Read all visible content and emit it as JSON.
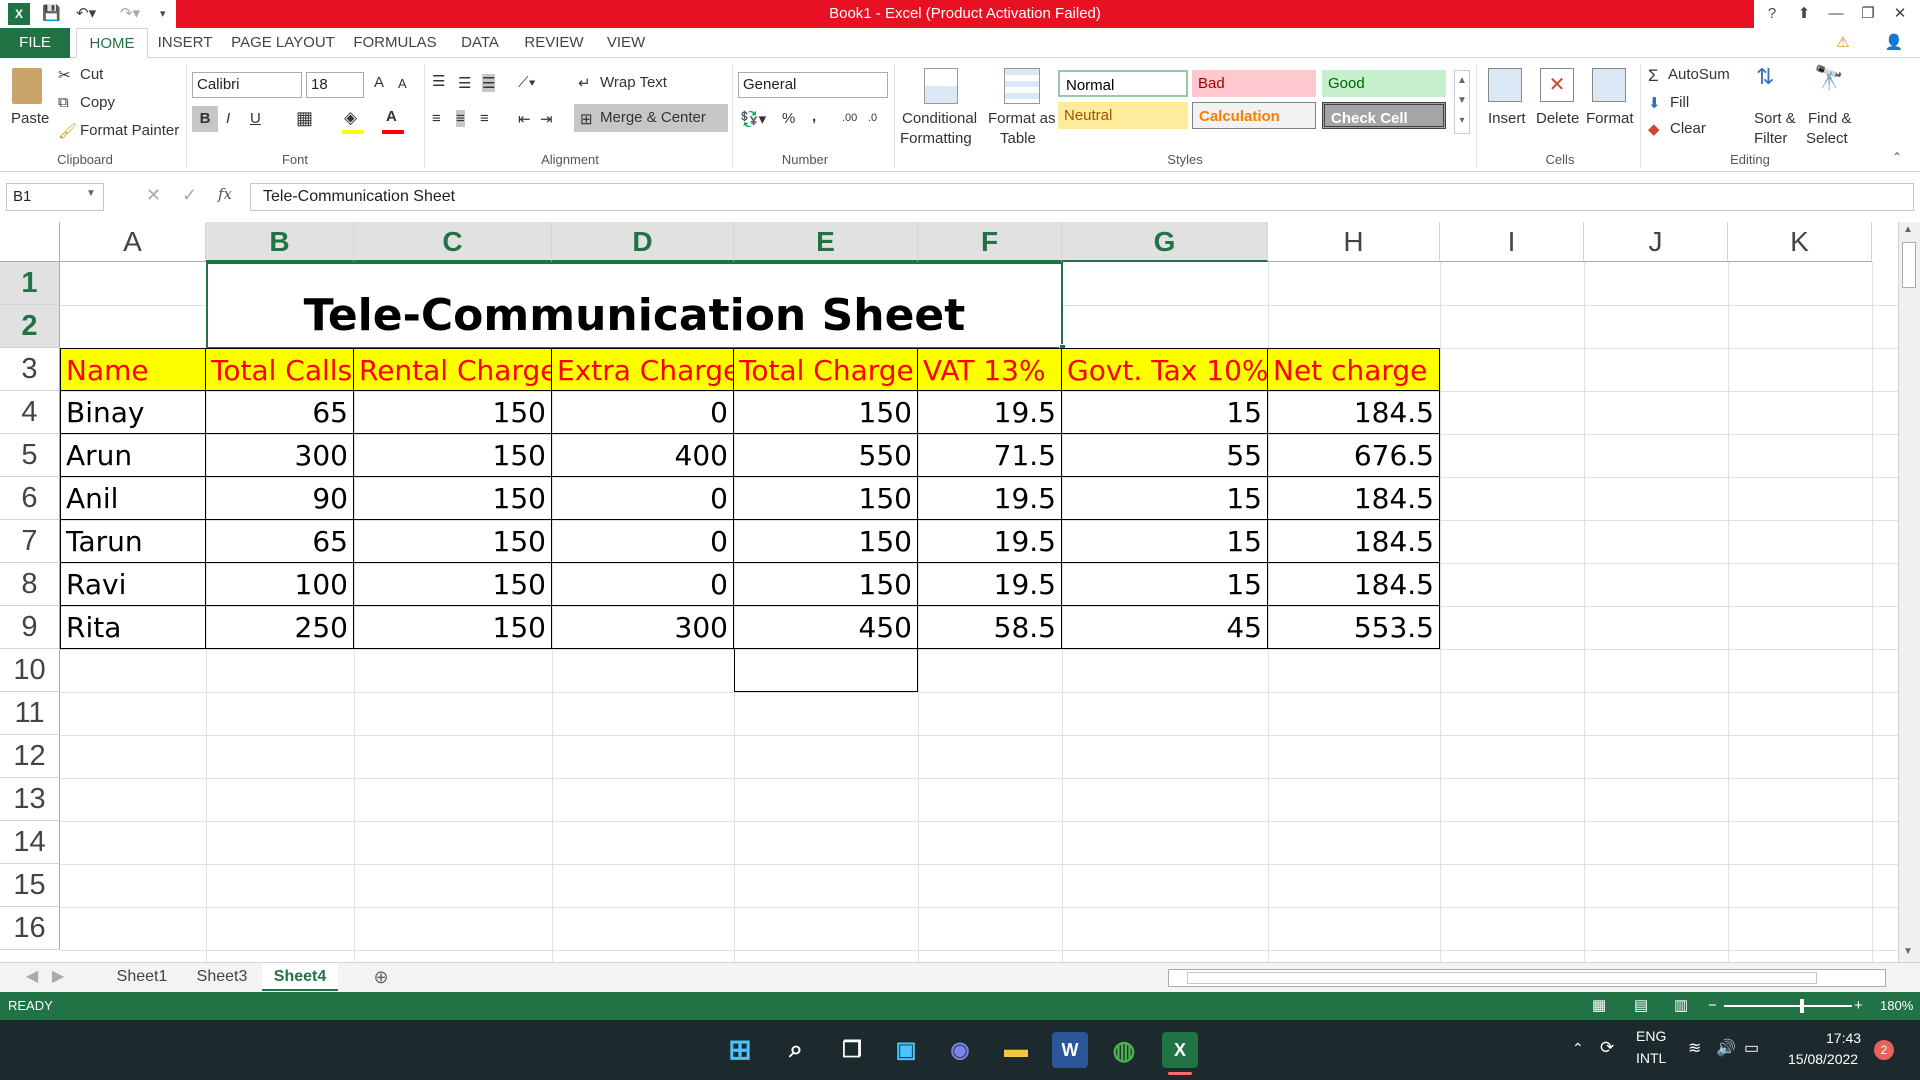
{
  "titlebar": {
    "title": "Book1  -  Excel (Product Activation Failed)",
    "help": "?",
    "minimize": "—",
    "restore": "❐",
    "close": "✕"
  },
  "tabs": [
    "FILE",
    "HOME",
    "INSERT",
    "PAGE LAYOUT",
    "FORMULAS",
    "DATA",
    "REVIEW",
    "VIEW"
  ],
  "ribbon": {
    "clipboard": {
      "paste": "Paste",
      "cut": "Cut",
      "copy": "Copy",
      "format_painter": "Format Painter",
      "label": "Clipboard"
    },
    "font": {
      "family": "Calibri",
      "size": "18",
      "bold": "B",
      "italic": "I",
      "underline": "U",
      "label": "Font"
    },
    "alignment": {
      "wrap_text": "Wrap Text",
      "merge_center": "Merge & Center",
      "label": "Alignment"
    },
    "number": {
      "format": "General",
      "percent": "%",
      "comma": ",",
      "label": "Number"
    },
    "styles": {
      "conditional_1": "Conditional",
      "conditional_2": "Formatting",
      "format_table_1": "Format as",
      "format_table_2": "Table",
      "normal": "Normal",
      "bad": "Bad",
      "good": "Good",
      "neutral": "Neutral",
      "calculation": "Calculation",
      "check_cell": "Check Cell",
      "label": "Styles"
    },
    "cells": {
      "insert": "Insert",
      "delete": "Delete",
      "format": "Format",
      "label": "Cells"
    },
    "editing": {
      "autosum": "AutoSum",
      "fill": "Fill",
      "clear": "Clear",
      "sort_1": "Sort &",
      "sort_2": "Filter",
      "find_1": "Find &",
      "find_2": "Select",
      "label": "Editing"
    }
  },
  "formula_bar": {
    "name_box": "B1",
    "fx": "fx",
    "content": "Tele-Communication Sheet"
  },
  "columns": [
    "A",
    "B",
    "C",
    "D",
    "E",
    "F",
    "G",
    "H",
    "I",
    "J",
    "K"
  ],
  "rows": [
    "1",
    "2",
    "3",
    "4",
    "5",
    "6",
    "7",
    "8",
    "9",
    "10",
    "11",
    "12",
    "13",
    "14",
    "15",
    "16"
  ],
  "sheet": {
    "title": "Tele-Communication Sheet",
    "headers": [
      "Name",
      "Total Calls",
      "Rental Charge",
      "Extra Charge",
      "Total Charge",
      "VAT 13%",
      "Govt. Tax 10%",
      "Net charge"
    ],
    "data": [
      [
        "Binay",
        "65",
        "150",
        "0",
        "150",
        "19.5",
        "15",
        "184.5"
      ],
      [
        "Arun",
        "300",
        "150",
        "400",
        "550",
        "71.5",
        "55",
        "676.5"
      ],
      [
        "Anil",
        "90",
        "150",
        "0",
        "150",
        "19.5",
        "15",
        "184.5"
      ],
      [
        "Tarun",
        "65",
        "150",
        "0",
        "150",
        "19.5",
        "15",
        "184.5"
      ],
      [
        "Ravi",
        "100",
        "150",
        "0",
        "150",
        "19.5",
        "15",
        "184.5"
      ],
      [
        "Rita",
        "250",
        "150",
        "300",
        "450",
        "58.5",
        "45",
        "553.5"
      ]
    ]
  },
  "sheet_tabs": [
    "Sheet1",
    "Sheet3",
    "Sheet4"
  ],
  "status": {
    "ready": "READY",
    "zoom": "180%"
  },
  "taskbar": {
    "lang_1": "ENG",
    "lang_2": "INTL",
    "time": "17:43",
    "date": "15/08/2022",
    "notifications": "2"
  }
}
